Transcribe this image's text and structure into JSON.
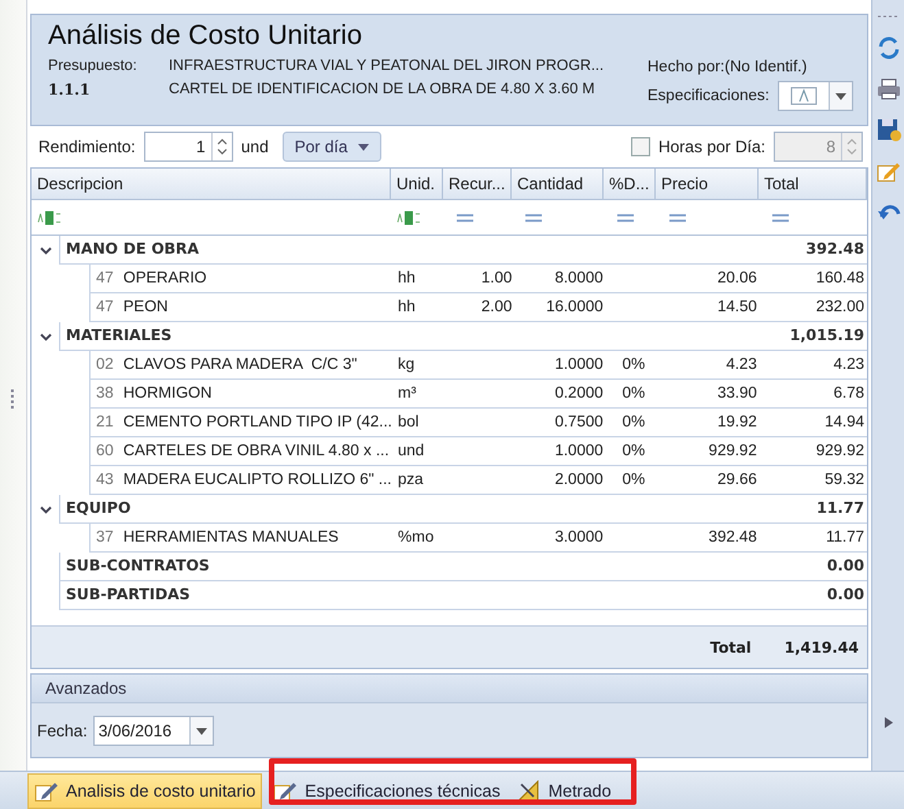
{
  "header": {
    "title": "Análisis de Costo Unitario",
    "budget_label": "Presupuesto:",
    "budget_name": "INFRAESTRUCTURA VIAL Y PEATONAL DEL JIRON PROGR...",
    "item_code": "1.1.1",
    "item_name": "CARTEL DE IDENTIFICACION DE LA OBRA DE 4.80 X 3.60 M",
    "made_by": "Hecho por:(No Identif.)",
    "specs_label": "Especificaciones:"
  },
  "toolbar": {
    "yield_label": "Rendimiento:",
    "yield_value": "1",
    "unit": "und",
    "period": "Por día",
    "hours_label": "Horas por Día:",
    "hours_checked": false,
    "hours_value": "8"
  },
  "table": {
    "columns": [
      "Descripcion",
      "Unid.",
      "Recur...",
      "Cantidad",
      "%D...",
      "Precio",
      "Total"
    ],
    "groups": [
      {
        "name": "MANO DE OBRA",
        "total": "392.48",
        "expanded": true,
        "children": [
          {
            "code": "47",
            "description": "OPERARIO",
            "unit": "hh",
            "resources": "1.00",
            "quantity": "8.0000",
            "price": "20.06",
            "total": "160.48"
          },
          {
            "code": "47",
            "description": "PEON",
            "unit": "hh",
            "resources": "2.00",
            "quantity": "16.0000",
            "price": "14.50",
            "total": "232.00"
          }
        ]
      },
      {
        "name": "MATERIALES",
        "total": "1,015.19",
        "expanded": true,
        "children": [
          {
            "code": "02",
            "description": "CLAVOS PARA MADERA  C/C 3\"",
            "unit": "kg",
            "quantity": "1.0000",
            "discount": "0%",
            "price": "4.23",
            "total": "4.23"
          },
          {
            "code": "38",
            "description": "HORMIGON",
            "unit": "m³",
            "quantity": "0.2000",
            "discount": "0%",
            "price": "33.90",
            "total": "6.78"
          },
          {
            "code": "21",
            "description": "CEMENTO PORTLAND TIPO IP (42...",
            "unit": "bol",
            "quantity": "0.7500",
            "discount": "0%",
            "price": "19.92",
            "total": "14.94"
          },
          {
            "code": "60",
            "description": "CARTELES DE OBRA VINIL 4.80 x ...",
            "unit": "und",
            "quantity": "1.0000",
            "discount": "0%",
            "price": "929.92",
            "total": "929.92"
          },
          {
            "code": "43",
            "description": "MADERA EUCALIPTO ROLLIZO 6\" ...",
            "unit": "pza",
            "quantity": "2.0000",
            "discount": "0%",
            "price": "29.66",
            "total": "59.32"
          }
        ]
      },
      {
        "name": "EQUIPO",
        "total": "11.77",
        "expanded": true,
        "children": [
          {
            "code": "37",
            "description": "HERRAMIENTAS MANUALES",
            "unit": "%mo",
            "quantity": "3.0000",
            "price": "392.48",
            "total": "11.77"
          }
        ]
      },
      {
        "name": "SUB-CONTRATOS",
        "total": "0.00"
      },
      {
        "name": "SUB-PARTIDAS",
        "total": "0.00"
      }
    ],
    "footer_label": "Total",
    "footer_total": "1,419.44"
  },
  "advanced": {
    "title": "Avanzados",
    "date_label": "Fecha:",
    "date_value": "3/06/2016"
  },
  "tabs": [
    {
      "label": "Analisis de costo unitario",
      "selected": true,
      "kind": "edit"
    },
    {
      "label": "Especificaciones técnicas",
      "selected": false,
      "kind": "edit"
    },
    {
      "label": "Metrado",
      "selected": false,
      "kind": "measure"
    }
  ]
}
